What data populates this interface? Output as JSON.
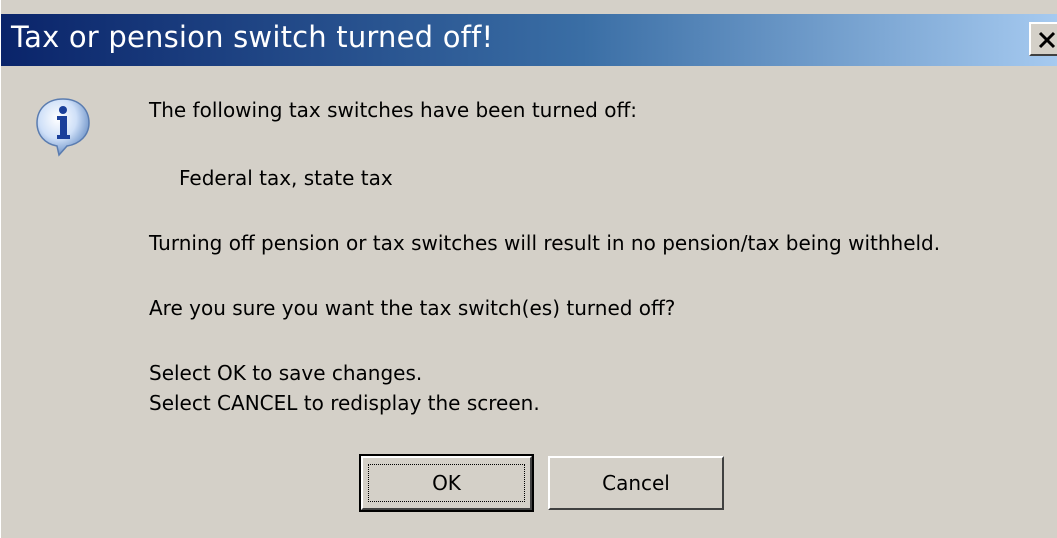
{
  "window": {
    "title": "Tax or pension switch turned off!",
    "close_glyph": "✕"
  },
  "icon": {
    "name": "info-icon",
    "glyph": "i"
  },
  "message": {
    "line1": "The following tax switches have been turned off:",
    "switches": "Federal tax, state tax",
    "warning": "Turning off pension or tax switches will result in no pension/tax being withheld.",
    "question": "Are you sure you want the tax switch(es) turned off?",
    "instruction_ok": "Select OK to save changes.",
    "instruction_cancel": "Select CANCEL to redisplay the screen."
  },
  "buttons": {
    "ok_label": "OK",
    "cancel_label": "Cancel"
  },
  "colors": {
    "dialog_bg": "#d4d0c8",
    "title_start": "#0a246a",
    "title_end": "#a6caf0",
    "title_text": "#ffffff"
  }
}
